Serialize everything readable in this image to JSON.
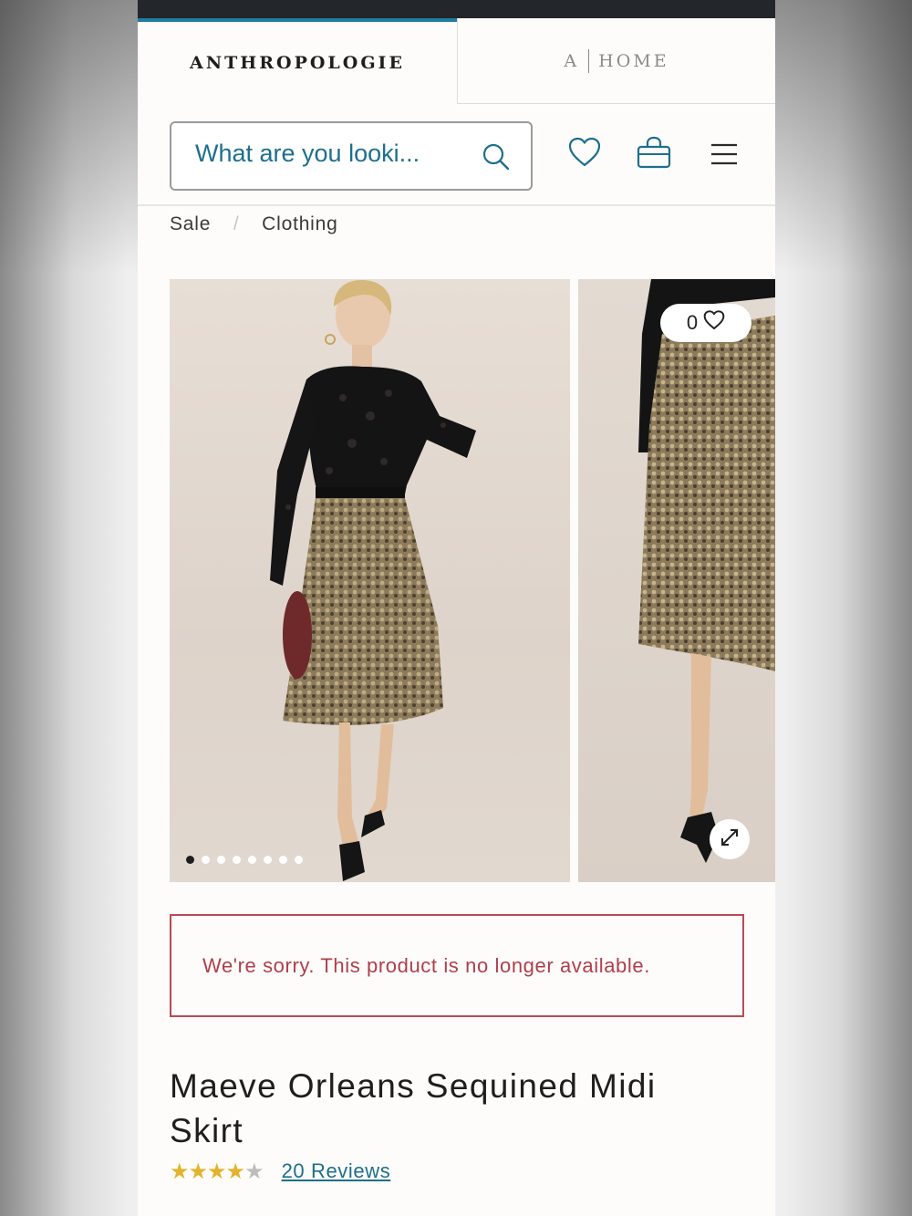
{
  "brand": {
    "primary": "ANTHROPOLOGIE",
    "home_mark": "A",
    "home_label": "HOME",
    "accent_color": "#1f7da0"
  },
  "search": {
    "placeholder": "What are you looki..."
  },
  "header_icons": [
    "search-icon",
    "heart-icon",
    "shopping-bag-icon",
    "menu-icon"
  ],
  "breadcrumb": {
    "items": [
      "Sale",
      "Clothing"
    ],
    "separator": "/"
  },
  "gallery": {
    "image_count": 8,
    "active_index": 0,
    "like_count": "0"
  },
  "notice": {
    "message": "We're sorry. This product is no longer available.",
    "color": "#b03e4b"
  },
  "product": {
    "title": "Maeve Orleans Sequined Midi Skirt",
    "rating": 4,
    "rating_max": 5,
    "reviews_label": "20 Reviews",
    "star_color": "#e3b32d"
  }
}
